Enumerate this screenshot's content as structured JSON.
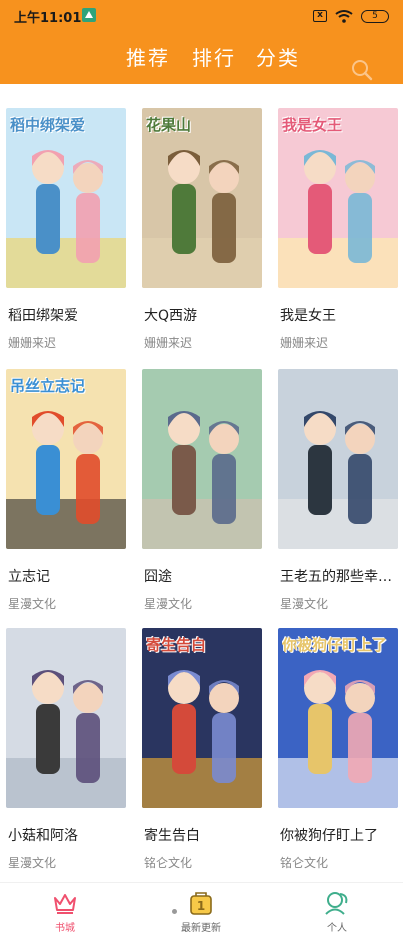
{
  "status": {
    "time": "上午11:01",
    "battery": "5",
    "sim": "x"
  },
  "tabs": [
    "推荐",
    "排行",
    "分类"
  ],
  "icons": {
    "search": "search-icon",
    "wifi": "wifi-icon",
    "battery": "battery-icon"
  },
  "colors": {
    "accent": "#f7921e",
    "tab_active": "#f0506e"
  },
  "books": [
    {
      "title": "稻田绑架爱",
      "author": "姗姗来迟",
      "cover_text": "稻中绑架爱",
      "palette": [
        "#c9e6f5",
        "#f2a0b0",
        "#4a90c8",
        "#f5d35c"
      ]
    },
    {
      "title": "大Q西游",
      "author": "姗姗来迟",
      "cover_text": "花果山",
      "palette": [
        "#d8c6a8",
        "#7b5e3b",
        "#4f7a3a",
        "#e4d3b2"
      ]
    },
    {
      "title": "我是女王",
      "author": "姗姗来迟",
      "cover_text": "我是女王",
      "palette": [
        "#f6c9d4",
        "#7ab8d6",
        "#e45a78",
        "#fff1a8"
      ]
    },
    {
      "title": "立志记",
      "author": "星漫文化",
      "cover_text": "吊丝立志记",
      "palette": [
        "#f5e2b0",
        "#e14c2b",
        "#3a8fd4",
        "#2b2b2b"
      ]
    },
    {
      "title": "囧途",
      "author": "星漫文化",
      "cover_text": "",
      "palette": [
        "#a5cbb0",
        "#5a6a8c",
        "#7a5a4a",
        "#d6c0b0"
      ]
    },
    {
      "title": "王老五的那些幸福事",
      "author": "星漫文化",
      "cover_text": "",
      "palette": [
        "#c8d2dc",
        "#34486a",
        "#2c3640",
        "#e8e8e8"
      ]
    },
    {
      "title": "小菇和阿洛",
      "author": "星漫文化",
      "cover_text": "",
      "palette": [
        "#d5dbe4",
        "#5c4f7a",
        "#3a3a3a",
        "#a8b2c2"
      ]
    },
    {
      "title": "寄生告白",
      "author": "铭仑文化",
      "cover_text": "寄生告白",
      "palette": [
        "#2a3560",
        "#7a8bd0",
        "#d44a3a",
        "#f5b030"
      ]
    },
    {
      "title": "你被狗仔盯上了",
      "author": "铭仑文化",
      "cover_text": "你被狗仔盯上了",
      "palette": [
        "#3b63c4",
        "#f2a8b4",
        "#e7c56a",
        "#ffffff"
      ]
    }
  ],
  "tabbar": [
    {
      "label": "书城",
      "icon": "crown-icon",
      "active": true
    },
    {
      "label": "最新更新",
      "icon": "badge-1-icon",
      "active": false
    },
    {
      "label": "个人",
      "icon": "people-icon",
      "active": false
    }
  ]
}
